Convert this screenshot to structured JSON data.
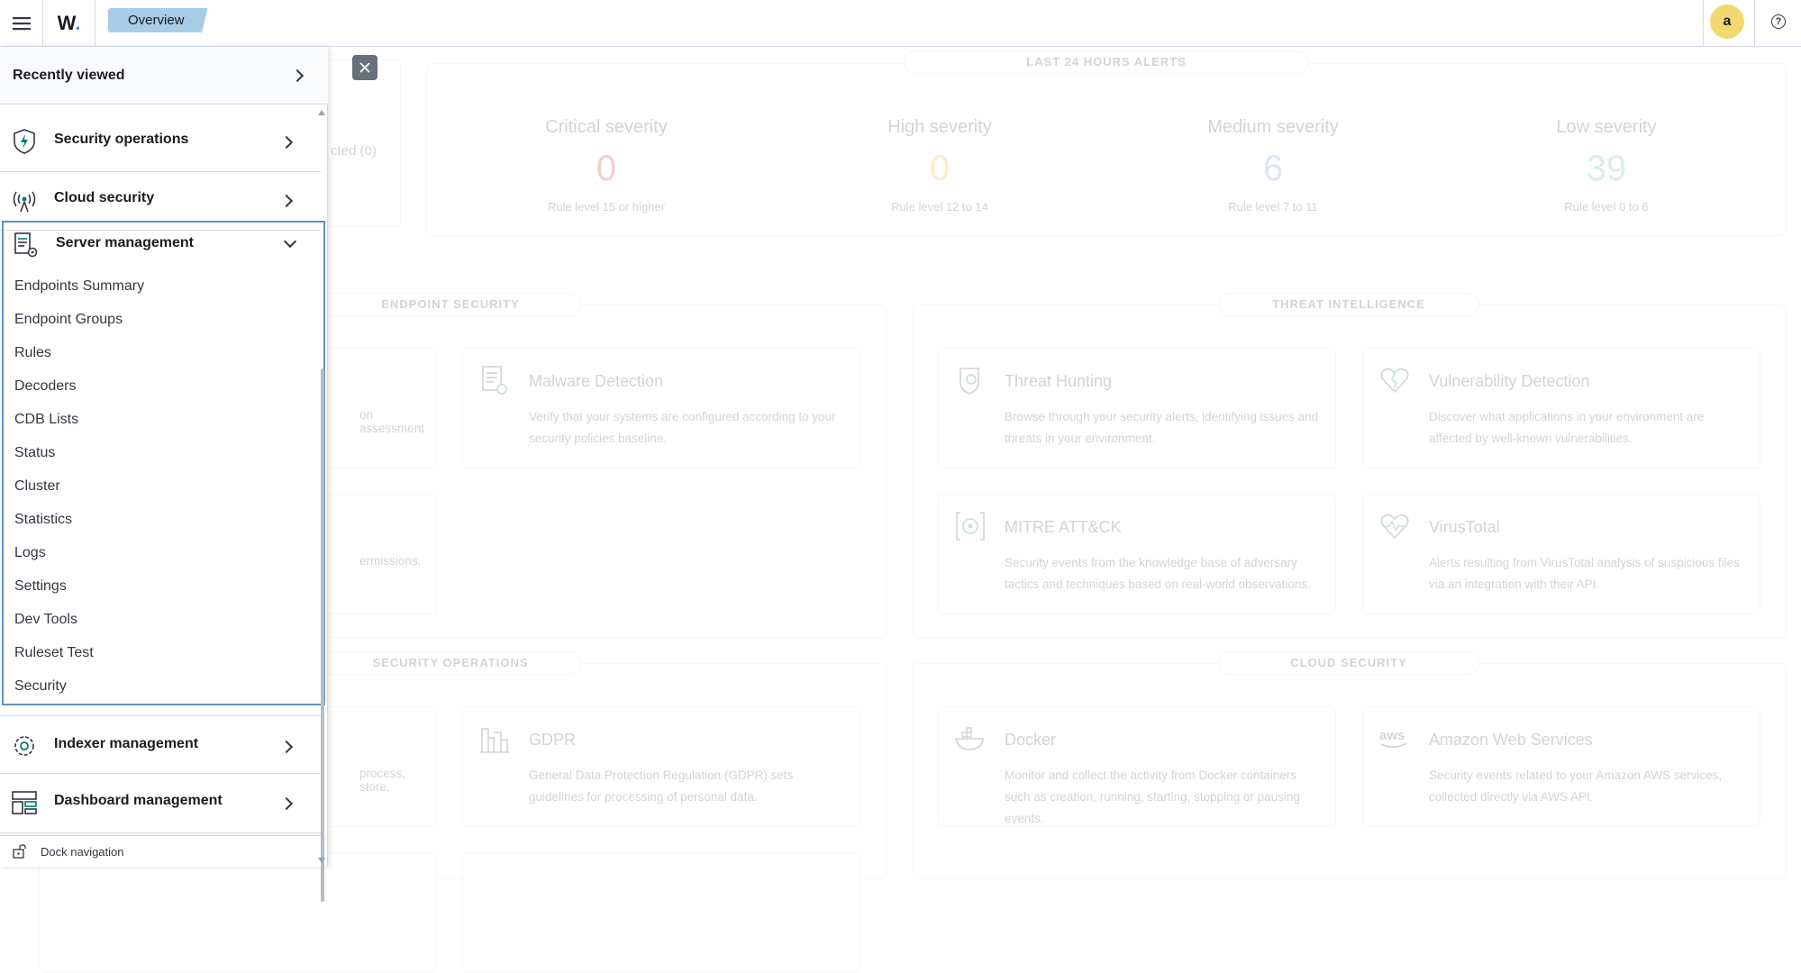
{
  "header": {
    "logo": "W.",
    "breadcrumb": "Overview",
    "avatar_initial": "a",
    "help_glyph": "?"
  },
  "alerts": {
    "title": "LAST 24 HOURS ALERTS",
    "items": [
      {
        "label": "Critical severity",
        "value": "0",
        "rule": "Rule level 15 or higher",
        "color": "#bd271e"
      },
      {
        "label": "High severity",
        "value": "0",
        "rule": "Rule level 12 to 14",
        "color": "#f5a700"
      },
      {
        "label": "Medium severity",
        "value": "6",
        "rule": "Rule level 7 to 11",
        "color": "#6092c0"
      },
      {
        "label": "Low severity",
        "value": "39",
        "rule": "Rule level 0 to 6",
        "color": "#54b399"
      }
    ]
  },
  "agents_fragment": "cted (0)",
  "sections": {
    "endpoint_security": "ENDPOINT SECURITY",
    "threat_intelligence": "THREAT INTELLIGENCE",
    "security_operations": "SECURITY OPERATIONS",
    "cloud_security": "CLOUD SECURITY"
  },
  "fragments": {
    "assessment": "on assessment",
    "permissions": "ermissions.",
    "process": "process, store,"
  },
  "cards": {
    "malware": {
      "title": "Malware Detection",
      "desc": "Verify that your systems are configured according to your security policies baseline."
    },
    "threat_hunting": {
      "title": "Threat Hunting",
      "desc": "Browse through your security alerts, identifying issues and threats in your environment."
    },
    "vulnerability": {
      "title": "Vulnerability Detection",
      "desc": "Discover what applications in your environment are affected by well-known vulnerabilities."
    },
    "mitre": {
      "title": "MITRE ATT&CK",
      "desc": "Security events from the knowledge base of adversary tactics and techniques based on real-world observations."
    },
    "virustotal": {
      "title": "VirusTotal",
      "desc": "Alerts resulting from VirusTotal analysis of suspicious files via an integration with their API."
    },
    "gdpr": {
      "title": "GDPR",
      "desc": "General Data Protection Regulation (GDPR) sets guidelines for processing of personal data."
    },
    "docker": {
      "title": "Docker",
      "desc": "Monitor and collect the activity from Docker containers such as creation, running, starting, stopping or pausing events."
    },
    "aws": {
      "title": "Amazon Web Services",
      "desc": "Security events related to your Amazon AWS services, collected directly via AWS API."
    }
  },
  "nav": {
    "recently_viewed": "Recently viewed",
    "security_operations": "Security operations",
    "cloud_security": "Cloud security",
    "server_management": "Server management",
    "server_items": [
      "Endpoints Summary",
      "Endpoint Groups",
      "Rules",
      "Decoders",
      "CDB Lists",
      "Status",
      "Cluster",
      "Statistics",
      "Logs",
      "Settings",
      "Dev Tools",
      "Ruleset Test",
      "Security"
    ],
    "indexer_management": "Indexer management",
    "dashboard_management": "Dashboard management",
    "dock": "Dock navigation"
  },
  "colors": {
    "accent": "#6092c0",
    "breadcrumb_bg": "#a8cbe6",
    "avatar_bg": "#f1d86f",
    "icon_teal": "#017d73"
  }
}
